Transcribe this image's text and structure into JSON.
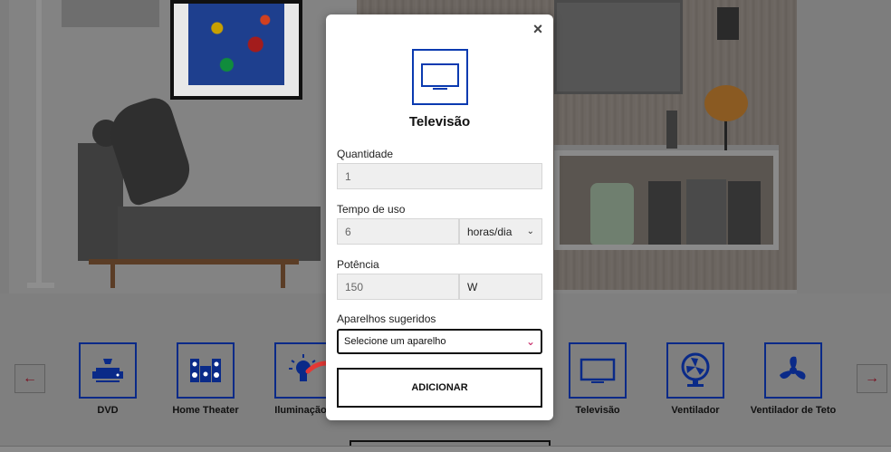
{
  "modal": {
    "title": "Televisão",
    "close_label": "×",
    "fields": {
      "quantity": {
        "label": "Quantidade",
        "value": "1"
      },
      "usage_time": {
        "label": "Tempo de uso",
        "value": "6",
        "unit": "horas/dia"
      },
      "power": {
        "label": "Potência",
        "value": "150",
        "unit": "W"
      },
      "suggested": {
        "label": "Aparelhos sugeridos",
        "value": "Selecione um aparelho"
      }
    },
    "add_button": "ADICIONAR",
    "icon": "tv-icon"
  },
  "carousel": {
    "prev": "←",
    "next": "→",
    "items": [
      {
        "label": "DVD",
        "icon": "dvd-icon"
      },
      {
        "label": "Home Theater",
        "icon": "home-theater-icon"
      },
      {
        "label": "Iluminação",
        "icon": "lightbulb-icon"
      },
      {
        "label": "Televisão",
        "icon": "tv-icon"
      },
      {
        "label": "Ventilador",
        "icon": "fan-icon"
      },
      {
        "label": "Ventilador de Teto",
        "icon": "ceiling-fan-icon"
      }
    ]
  },
  "colors": {
    "accent_blue": "#0a3ab0",
    "arrow_red": "#e53935",
    "chevron_pink": "#c2185b"
  }
}
